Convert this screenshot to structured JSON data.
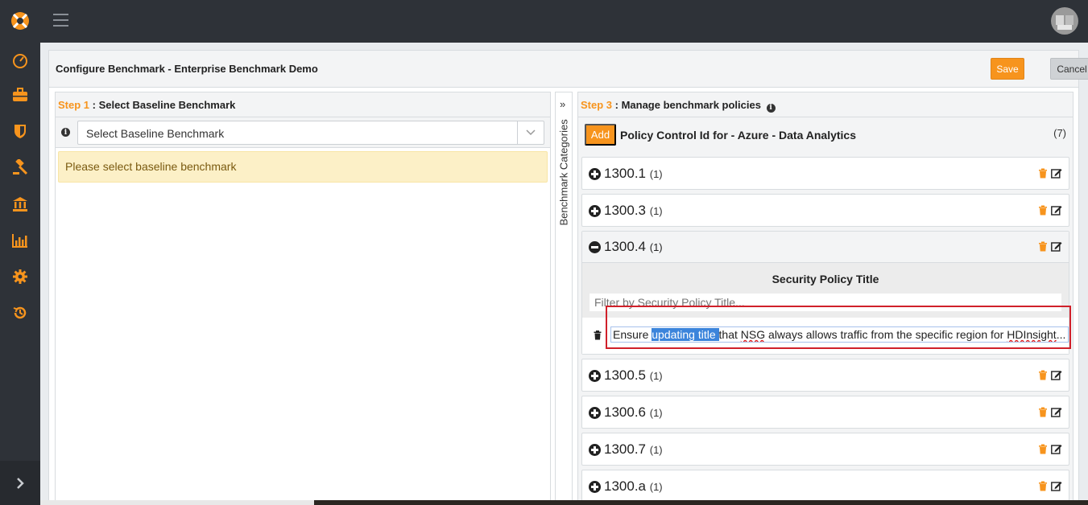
{
  "header": {
    "title": "Configure Benchmark - Enterprise Benchmark Demo",
    "save_label": "Save",
    "cancel_label": "Cancel"
  },
  "sidebar": {
    "items": [
      {
        "icon": "dashboard-gauge-icon"
      },
      {
        "icon": "briefcase-icon"
      },
      {
        "icon": "shield-icon"
      },
      {
        "icon": "gavel-icon"
      },
      {
        "icon": "bank-icon"
      },
      {
        "icon": "bar-chart-icon"
      },
      {
        "icon": "gear-icon"
      },
      {
        "icon": "history-icon"
      }
    ],
    "expand_icon": "chevron-right-icon"
  },
  "step1": {
    "step_label": "Step 1",
    "title": " : Select Baseline Benchmark",
    "select_value": "Select Baseline Benchmark",
    "alert": "Please select baseline benchmark"
  },
  "categories": {
    "label": "Benchmark Categories",
    "toggle": "»"
  },
  "step3": {
    "step_label": "Step 3",
    "title": " : Manage benchmark policies",
    "add_label": "Add",
    "policy_title": "Policy Control Id for - Azure - Data Analytics",
    "count": "(7)",
    "items": [
      {
        "id": "1300.1",
        "count": "(1)"
      },
      {
        "id": "1300.3",
        "count": "(1)"
      },
      {
        "id": "1300.4",
        "count": "(1)"
      },
      {
        "id": "1300.5",
        "count": "(1)"
      },
      {
        "id": "1300.6",
        "count": "(1)"
      },
      {
        "id": "1300.7",
        "count": "(1)"
      },
      {
        "id": "1300.a",
        "count": "(1)"
      }
    ],
    "expanded": {
      "column_title": "Security Policy Title",
      "filter_placeholder": "Filter by Security Policy Title...",
      "row_pre": "Ensure ",
      "row_selected": "updating title ",
      "row_mid": "that ",
      "row_squiggle": "NSG",
      "row_mid2": " always allows traffic from the specific region for ",
      "row_squiggle2": "HDInsight",
      "row_end": "..."
    }
  },
  "colors": {
    "accent": "#f7941d",
    "sidebar_bg": "#2e3238",
    "highlight_box": "#d0202a",
    "selection": "#3b84db"
  }
}
